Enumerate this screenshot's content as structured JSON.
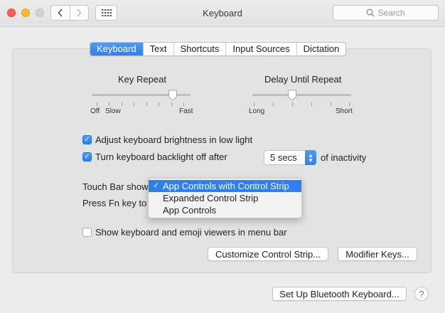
{
  "window": {
    "title": "Keyboard"
  },
  "search": {
    "placeholder": "Search",
    "icon": "search-icon"
  },
  "tabs": [
    {
      "label": "Keyboard",
      "active": true
    },
    {
      "label": "Text",
      "active": false
    },
    {
      "label": "Shortcuts",
      "active": false
    },
    {
      "label": "Input Sources",
      "active": false
    },
    {
      "label": "Dictation",
      "active": false
    }
  ],
  "key_repeat": {
    "title": "Key Repeat",
    "label_off": "Off",
    "label_slow": "Slow",
    "label_fast": "Fast",
    "level": 0.75
  },
  "delay_until_repeat": {
    "title": "Delay Until Repeat",
    "label_long": "Long",
    "label_short": "Short",
    "level": 0.4
  },
  "options": {
    "adjust_brightness": {
      "label": "Adjust keyboard brightness in low light",
      "checked": true
    },
    "backlight_off": {
      "label": "Turn keyboard backlight off after",
      "checked": true
    },
    "backlight_timeout": "5 secs",
    "inactivity_suffix": "of inactivity",
    "show_viewers": {
      "label": "Show keyboard and emoji viewers in menu bar",
      "checked": false
    }
  },
  "touch_bar": {
    "label": "Touch Bar shows",
    "fn_label": "Press Fn key to",
    "menu": [
      {
        "label": "App Controls with Control Strip",
        "selected": true
      },
      {
        "label": "Expanded Control Strip",
        "selected": false
      },
      {
        "label": "App Controls",
        "selected": false
      }
    ]
  },
  "buttons": {
    "customize": "Customize Control Strip...",
    "modifier": "Modifier Keys...",
    "bluetooth": "Set Up Bluetooth Keyboard...",
    "help": "?"
  },
  "colors": {
    "accent": "#2f7ff0"
  }
}
